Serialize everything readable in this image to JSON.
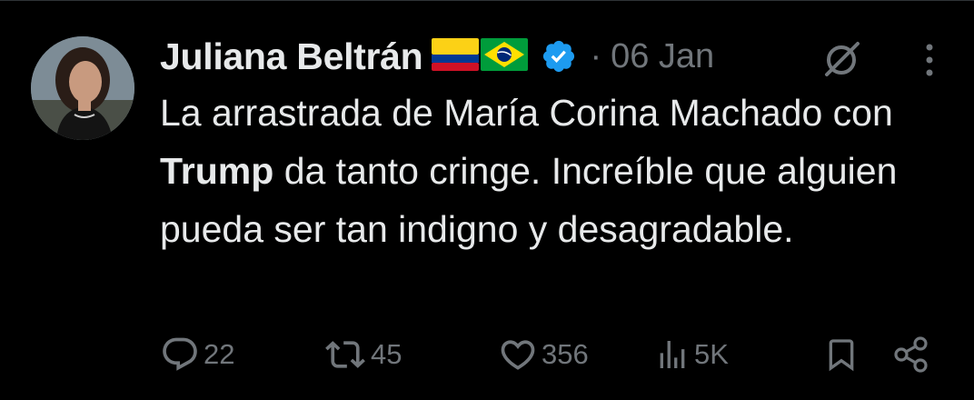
{
  "post": {
    "author_name": "Juliana Beltrán",
    "date": "06 Jan",
    "separator": "·",
    "text_part1": "La arrastrada de María Corina Machado con ",
    "text_bold": "Trump",
    "text_part2": " da tanto cringe. Increíble que alguien pueda ser tan indigno y desagradable.",
    "flags": [
      "colombia-flag",
      "brazil-flag"
    ],
    "verified": true
  },
  "actions": {
    "replies": "22",
    "reposts": "45",
    "likes": "356",
    "views": "5K"
  },
  "colors": {
    "background": "#000000",
    "text": "#e7e9ea",
    "muted": "#71767b",
    "verified_blue": "#1d9bf0"
  },
  "icons": [
    "grok-icon",
    "more-icon",
    "reply-icon",
    "repost-icon",
    "like-icon",
    "views-icon",
    "bookmark-icon",
    "share-icon"
  ]
}
